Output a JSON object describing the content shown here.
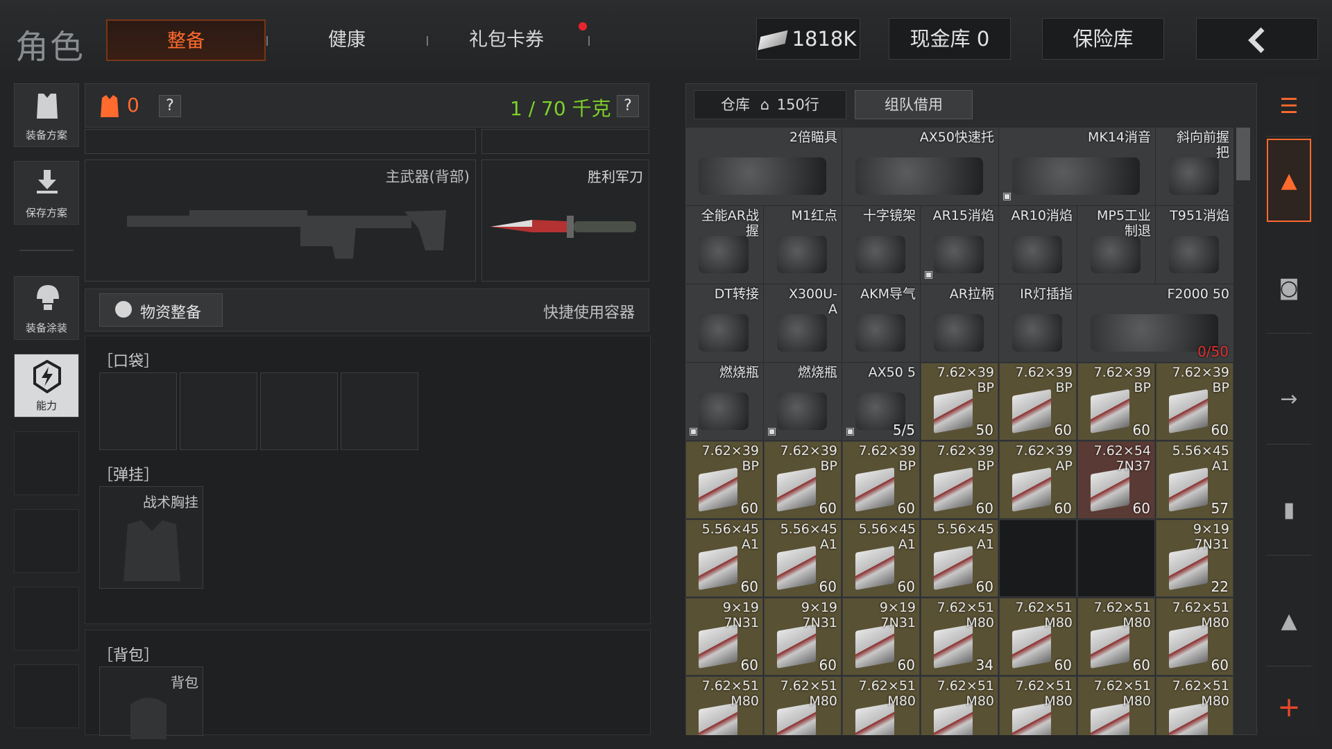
{
  "header": {
    "section_title": "角色",
    "tabs": [
      {
        "label": "整备",
        "active": true
      },
      {
        "label": "健康",
        "active": false
      },
      {
        "label": "礼包卡券",
        "active": false
      }
    ],
    "money": "1818K",
    "cash_vault": "现金库 0",
    "safe": "保险库"
  },
  "sidebar": {
    "items": [
      {
        "label": "装备方案",
        "icon": "vest-icon"
      },
      {
        "label": "保存方案",
        "icon": "download-icon"
      },
      {
        "label": "装备涂装",
        "icon": "helmet-paint-icon"
      },
      {
        "label": "能力",
        "icon": "ability-icon"
      }
    ]
  },
  "loadout": {
    "armor_value": "0",
    "weight": "1 / 70 千克",
    "primary_slot": "主武器(背部)",
    "melee_slot": "胜利军刀",
    "supply_button": "物资整备",
    "quick_container": "快捷使用容器",
    "pocket_label": "［口袋］",
    "rig_label": "［弹挂］",
    "rig_item": "战术胸挂",
    "backpack_label": "［背包］",
    "backpack_item": "背包",
    "colors": {
      "accent": "#ff6a2e",
      "weight": "#7fd12a"
    }
  },
  "inventory": {
    "tab_warehouse": "仓库",
    "tab_warehouse_rows": "150行",
    "tab_team": "组队借用",
    "rows": [
      [
        {
          "n1": "2倍瞄具",
          "n2": "",
          "count": "",
          "type": "item",
          "cube": false,
          "span": 2
        },
        {
          "n1": "AX50快速托",
          "n2": "",
          "count": "",
          "type": "item",
          "cube": false,
          "span": 2
        },
        {
          "n1": "MK14消音",
          "n2": "",
          "count": "",
          "type": "item",
          "cube": true,
          "span": 2
        },
        {
          "n1": "斜向前握",
          "n2": "把",
          "count": "",
          "type": "item",
          "cube": false,
          "span": 1
        }
      ],
      [
        {
          "n1": "全能AR战",
          "n2": "握",
          "count": "",
          "type": "item",
          "cube": false
        },
        {
          "n1": "M1红点",
          "n2": "",
          "count": "",
          "type": "item",
          "cube": false
        },
        {
          "n1": "十字镜架",
          "n2": "",
          "count": "",
          "type": "item",
          "cube": false
        },
        {
          "n1": "AR15消焰",
          "n2": "",
          "count": "",
          "type": "item",
          "cube": true
        },
        {
          "n1": "AR10消焰",
          "n2": "",
          "count": "",
          "type": "item",
          "cube": false
        },
        {
          "n1": "MP5工业",
          "n2": "制退",
          "count": "",
          "type": "item",
          "cube": false
        },
        {
          "n1": "T951消焰",
          "n2": "",
          "count": "",
          "type": "item",
          "cube": false
        }
      ],
      [
        {
          "n1": "DT转接",
          "n2": "",
          "count": "",
          "type": "item",
          "cube": false
        },
        {
          "n1": "X300U-",
          "n2": "A",
          "count": "",
          "type": "item",
          "cube": false
        },
        {
          "n1": "AKM导气",
          "n2": "",
          "count": "",
          "type": "item",
          "cube": false
        },
        {
          "n1": "AR拉柄",
          "n2": "",
          "count": "",
          "type": "item",
          "cube": false
        },
        {
          "n1": "IR灯插指",
          "n2": "",
          "count": "",
          "type": "item",
          "cube": false
        },
        {
          "n1": "F2000 50",
          "n2": "",
          "count": "0/50",
          "type": "item",
          "cube": false,
          "span": 2,
          "red": true
        }
      ],
      [
        {
          "n1": "燃烧瓶",
          "n2": "",
          "count": "",
          "type": "item",
          "cube": true
        },
        {
          "n1": "燃烧瓶",
          "n2": "",
          "count": "",
          "type": "item",
          "cube": true
        },
        {
          "n1": "AX50 5",
          "n2": "",
          "count": "5/5",
          "type": "item",
          "cube": true
        },
        {
          "n1": "7.62×39",
          "n2": "BP",
          "count": "50",
          "type": "ammo"
        },
        {
          "n1": "7.62×39",
          "n2": "BP",
          "count": "60",
          "type": "ammo"
        },
        {
          "n1": "7.62×39",
          "n2": "BP",
          "count": "60",
          "type": "ammo"
        },
        {
          "n1": "7.62×39",
          "n2": "BP",
          "count": "60",
          "type": "ammo"
        }
      ],
      [
        {
          "n1": "7.62×39",
          "n2": "BP",
          "count": "60",
          "type": "ammo"
        },
        {
          "n1": "7.62×39",
          "n2": "BP",
          "count": "60",
          "type": "ammo"
        },
        {
          "n1": "7.62×39",
          "n2": "BP",
          "count": "60",
          "type": "ammo"
        },
        {
          "n1": "7.62×39",
          "n2": "BP",
          "count": "60",
          "type": "ammo"
        },
        {
          "n1": "7.62×39",
          "n2": "AP",
          "count": "60",
          "type": "ammo"
        },
        {
          "n1": "7.62×54",
          "n2": "7N37",
          "count": "60",
          "type": "ammo-red"
        },
        {
          "n1": "5.56×45",
          "n2": "A1",
          "count": "57",
          "type": "ammo"
        }
      ],
      [
        {
          "n1": "5.56×45",
          "n2": "A1",
          "count": "60",
          "type": "ammo"
        },
        {
          "n1": "5.56×45",
          "n2": "A1",
          "count": "60",
          "type": "ammo"
        },
        {
          "n1": "5.56×45",
          "n2": "A1",
          "count": "60",
          "type": "ammo"
        },
        {
          "n1": "5.56×45",
          "n2": "A1",
          "count": "60",
          "type": "ammo"
        },
        {
          "n1": "",
          "n2": "",
          "count": "",
          "type": "empty"
        },
        {
          "n1": "",
          "n2": "",
          "count": "",
          "type": "empty"
        },
        {
          "n1": "9×19",
          "n2": "7N31",
          "count": "22",
          "type": "ammo"
        }
      ],
      [
        {
          "n1": "9×19",
          "n2": "7N31",
          "count": "60",
          "type": "ammo"
        },
        {
          "n1": "9×19",
          "n2": "7N31",
          "count": "60",
          "type": "ammo"
        },
        {
          "n1": "9×19",
          "n2": "7N31",
          "count": "60",
          "type": "ammo"
        },
        {
          "n1": "7.62×51",
          "n2": "M80",
          "count": "34",
          "type": "ammo"
        },
        {
          "n1": "7.62×51",
          "n2": "M80",
          "count": "60",
          "type": "ammo"
        },
        {
          "n1": "7.62×51",
          "n2": "M80",
          "count": "60",
          "type": "ammo"
        },
        {
          "n1": "7.62×51",
          "n2": "M80",
          "count": "60",
          "type": "ammo"
        }
      ],
      [
        {
          "n1": "7.62×51",
          "n2": "M80",
          "count": "",
          "type": "ammo"
        },
        {
          "n1": "7.62×51",
          "n2": "M80",
          "count": "",
          "type": "ammo"
        },
        {
          "n1": "7.62×51",
          "n2": "M80",
          "count": "",
          "type": "ammo"
        },
        {
          "n1": "7.62×51",
          "n2": "M80",
          "count": "",
          "type": "ammo"
        },
        {
          "n1": "7.62×51",
          "n2": "M80",
          "count": "",
          "type": "ammo"
        },
        {
          "n1": "7.62×51",
          "n2": "M80",
          "count": "",
          "type": "ammo"
        },
        {
          "n1": "7.62×51",
          "n2": "M80",
          "count": "",
          "type": "ammo"
        }
      ]
    ]
  },
  "right_rail": {
    "items": [
      {
        "icon": "stack-icon",
        "active": false
      },
      {
        "icon": "warehouse-icon",
        "active": true
      },
      {
        "icon": "helmet-icon",
        "active": false
      },
      {
        "icon": "rifle-icon",
        "active": false
      },
      {
        "icon": "magazine-icon",
        "active": false
      },
      {
        "icon": "bullet-icon",
        "active": false
      },
      {
        "icon": "plus-icon",
        "active": false
      }
    ]
  }
}
